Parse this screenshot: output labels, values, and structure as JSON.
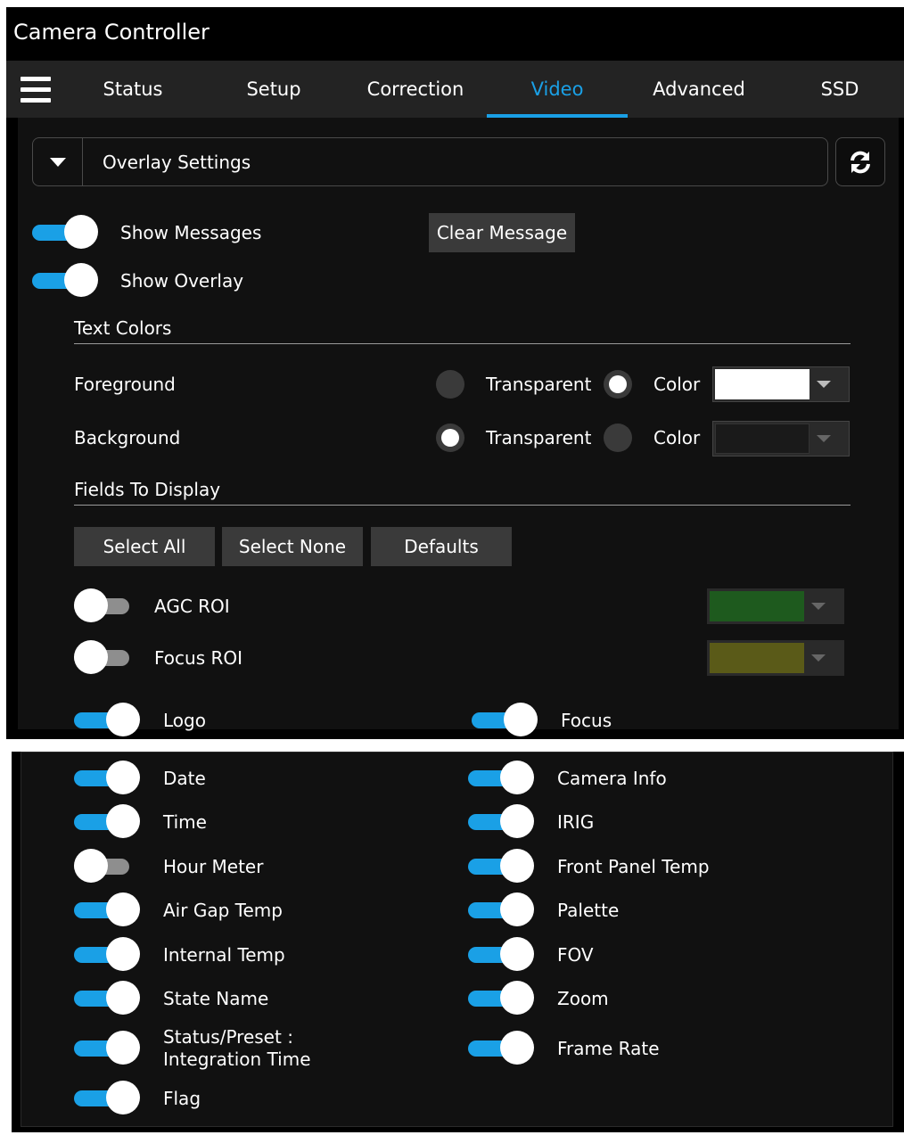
{
  "app": {
    "title": "Camera Controller"
  },
  "tabs": [
    {
      "label": "Status",
      "active": false
    },
    {
      "label": "Setup",
      "active": false
    },
    {
      "label": "Correction",
      "active": false
    },
    {
      "label": "Video",
      "active": true
    },
    {
      "label": "Advanced",
      "active": false
    },
    {
      "label": "SSD",
      "active": false
    }
  ],
  "overlay": {
    "header": "Overlay Settings",
    "show_messages": {
      "label": "Show Messages",
      "on": true
    },
    "clear_message": "Clear Message",
    "show_overlay": {
      "label": "Show Overlay",
      "on": true
    },
    "text_colors": {
      "title": "Text Colors",
      "foreground": {
        "label": "Foreground",
        "transparent": "Transparent",
        "color": "Color",
        "selected": "Color",
        "swatch": "#ffffff"
      },
      "background": {
        "label": "Background",
        "transparent": "Transparent",
        "color": "Color",
        "selected": "Transparent",
        "swatch": "#1a1a1a"
      }
    },
    "fields": {
      "title": "Fields To Display",
      "buttons": {
        "select_all": "Select All",
        "select_none": "Select None",
        "defaults": "Defaults"
      },
      "agc_roi": {
        "label": "AGC ROI",
        "on": false,
        "swatch": "#1e5a1e"
      },
      "focus_roi": {
        "label": "Focus ROI",
        "on": false,
        "swatch": "#5a5a18"
      },
      "logo": {
        "label": "Logo",
        "on": true
      },
      "focus": {
        "label": "Focus",
        "on": true
      },
      "left": [
        {
          "label": "Date",
          "on": true
        },
        {
          "label": "Time",
          "on": true
        },
        {
          "label": "Hour Meter",
          "on": false
        },
        {
          "label": "Air Gap Temp",
          "on": true
        },
        {
          "label": "Internal Temp",
          "on": true
        },
        {
          "label": "State Name",
          "on": true
        },
        {
          "label": "Status/Preset : Integration Time",
          "on": true
        },
        {
          "label": "Flag",
          "on": true
        }
      ],
      "right": [
        {
          "label": "Camera Info",
          "on": true
        },
        {
          "label": "IRIG",
          "on": true
        },
        {
          "label": "Front Panel Temp",
          "on": true
        },
        {
          "label": "Palette",
          "on": true
        },
        {
          "label": "FOV",
          "on": true
        },
        {
          "label": "Zoom",
          "on": true
        },
        {
          "label": "Frame Rate",
          "on": true
        }
      ]
    }
  },
  "icons": {
    "menu": "hamburger-icon",
    "refresh": "refresh-icon",
    "collapse": "caret-down-icon"
  },
  "colors": {
    "accent": "#1aa0e6",
    "panel": "#111111",
    "button": "#3a3a3a"
  }
}
